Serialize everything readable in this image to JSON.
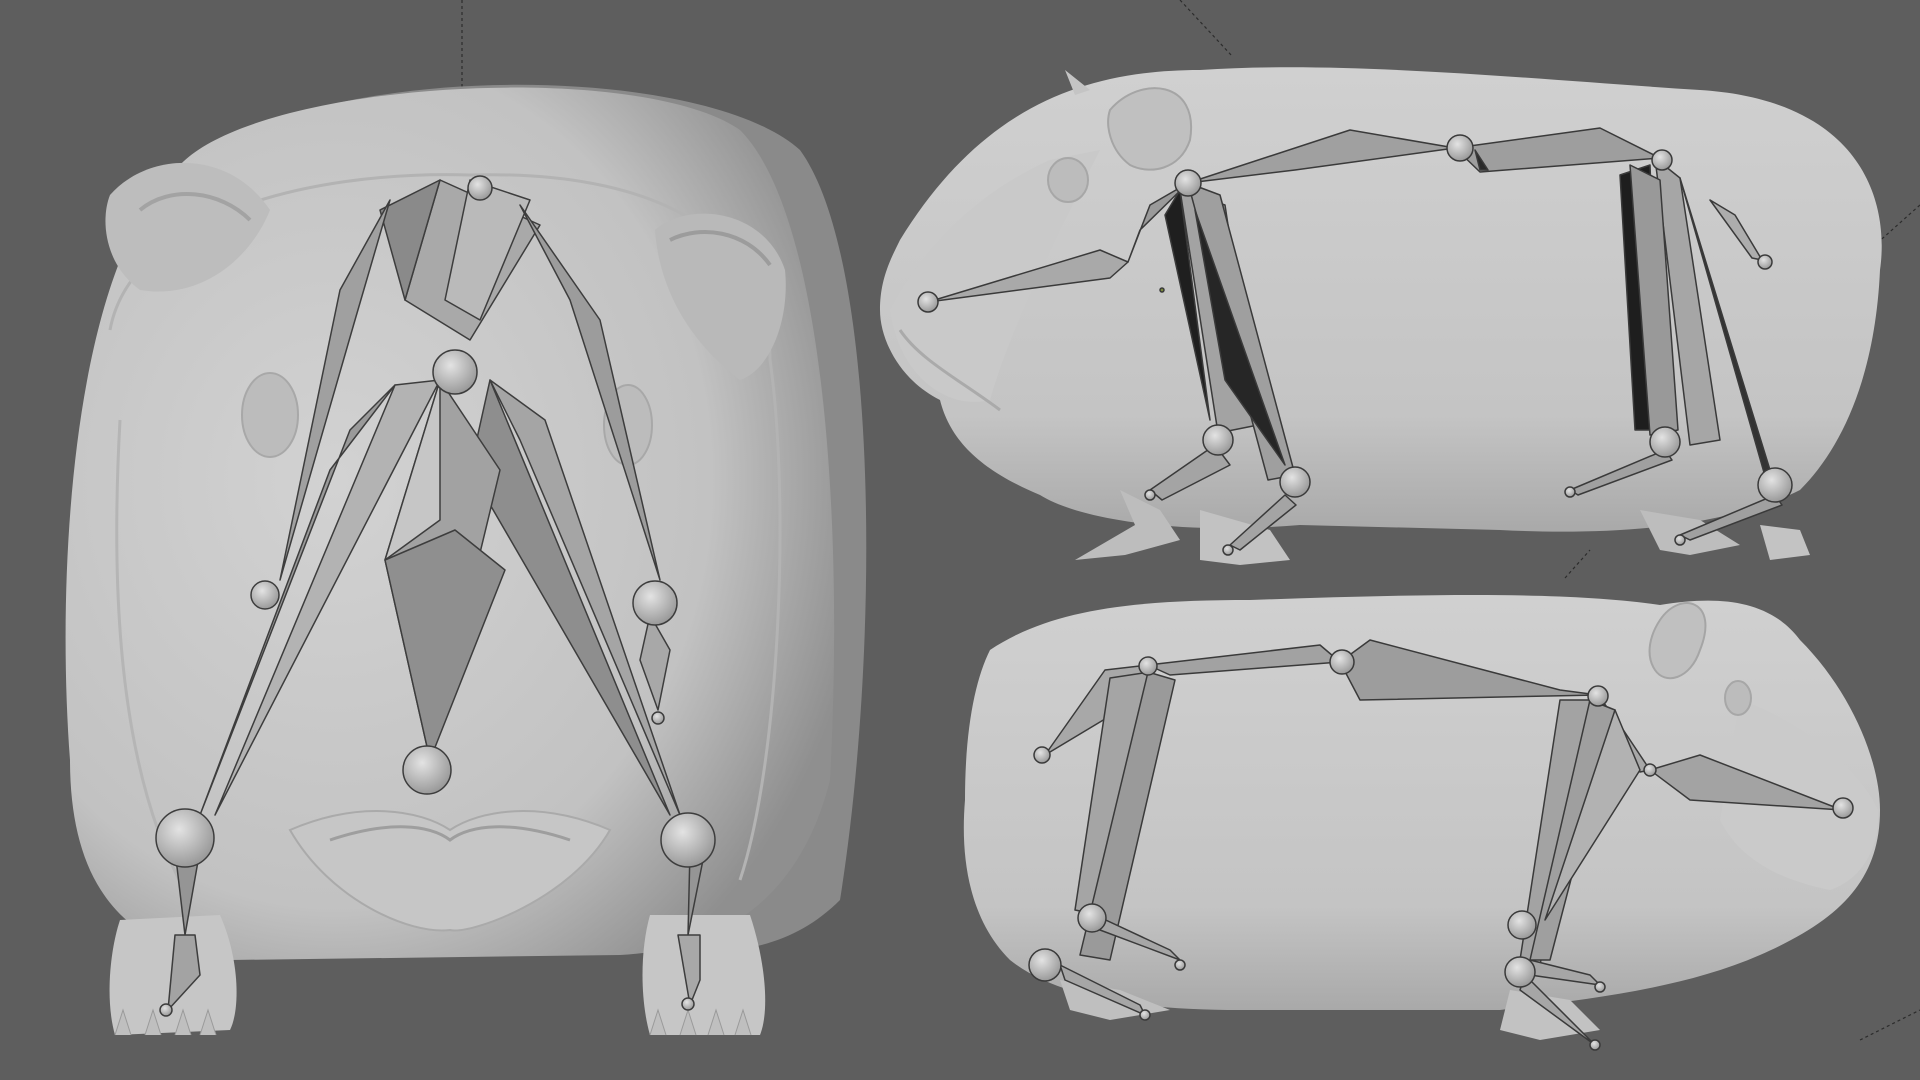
{
  "scene": {
    "background_color": "#5e5e5e",
    "mesh_color": "#c9c9c9",
    "bone_light": "#9a9a9a",
    "bone_dark": "#444444",
    "views": [
      "front-view",
      "side-view-left-facing",
      "side-view-right-facing"
    ]
  }
}
